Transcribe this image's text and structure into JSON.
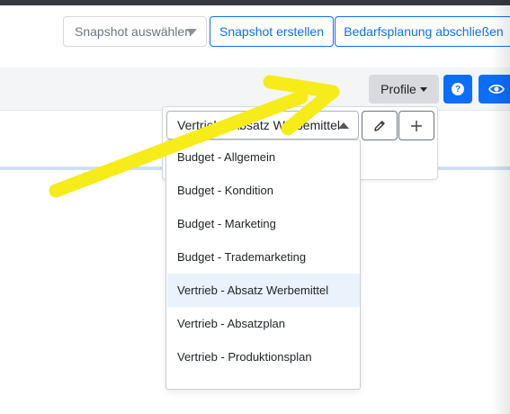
{
  "header": {
    "snapshot_select_placeholder": "Snapshot auswählen",
    "create_snapshot_label": "Snapshot erstellen",
    "finish_planning_label": "Bedarfsplanung abschließen"
  },
  "toolbar": {
    "profile_label": "Profile",
    "help_icon": "question-circle-icon",
    "view_icon": "eye-icon"
  },
  "profile_panel": {
    "selected_value": "Vertrieb - Absatz Werbemittel",
    "edit_icon": "pencil-icon",
    "add_icon": "plus-icon",
    "options": [
      "Budget - Allgemein",
      "Budget - Kondition",
      "Budget - Marketing",
      "Budget - Trademarketing",
      "Vertrieb - Absatz Werbemittel",
      "Vertrieb - Absatzplan",
      "Vertrieb - Produktionsplan"
    ]
  },
  "annotation": {
    "type": "yellow-arrow",
    "color": "#f5ec1a"
  },
  "colors": {
    "primary": "#0d6efd",
    "active_option_bg": "#eaf2fc",
    "dark_header": "#343a40"
  }
}
